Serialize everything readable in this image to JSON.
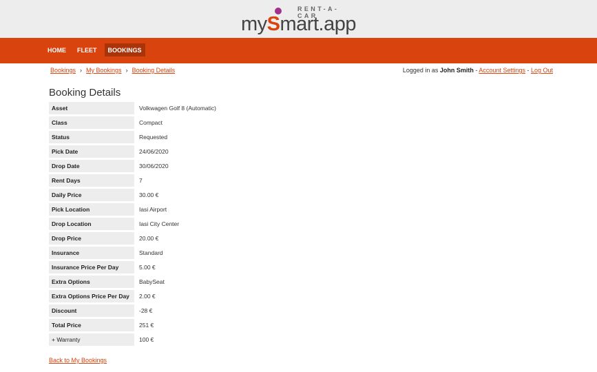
{
  "header": {
    "logo_tag": "RENT-A-CAR",
    "logo_prefix": "my",
    "logo_s": "S",
    "logo_suffix": "mart.app"
  },
  "nav": {
    "home": "HOME",
    "fleet": "FLEET",
    "bookings": "BOOKINGS"
  },
  "breadcrumb": {
    "items": [
      "Bookings",
      "My Bookings",
      "Booking Details"
    ],
    "separator": "›"
  },
  "user": {
    "logged_in_prefix": "Logged in as ",
    "name": "John Smith",
    "dash1": " - ",
    "account_settings": "Account Settings",
    "dash2": " - ",
    "logout": "Log Out"
  },
  "page_title": "Booking Details",
  "details": [
    {
      "label": "Asset",
      "value": "Volkwagen Golf 8 (Automatic)"
    },
    {
      "label": "Class",
      "value": "Compact"
    },
    {
      "label": "Status",
      "value": "Requested"
    },
    {
      "label": "Pick Date",
      "value": "24/06/2020"
    },
    {
      "label": "Drop Date",
      "value": "30/06/2020"
    },
    {
      "label": "Rent Days",
      "value": "7"
    },
    {
      "label": "Daily Price",
      "value": "30.00 €"
    },
    {
      "label": "Pick Location",
      "value": "Iasi Airport"
    },
    {
      "label": "Drop Location",
      "value": "Iasi City Center"
    },
    {
      "label": "Drop Price",
      "value": "20.00 €"
    },
    {
      "label": "Insurance",
      "value": "Standard"
    },
    {
      "label": "Insurance Price Per Day",
      "value": "5.00 €"
    },
    {
      "label": "Extra Options",
      "value": "BabySeat"
    },
    {
      "label": "Extra Options Price Per Day",
      "value": "2.00 €"
    },
    {
      "label": "Discount",
      "value": "-28 €"
    },
    {
      "label": "Total Price",
      "value": "251 €"
    },
    {
      "label": "+ Warranty",
      "value": "100 €"
    }
  ],
  "back_link": "Back to My Bookings",
  "colors": {
    "accent": "#d9430d",
    "header_bg": "#ededed",
    "label_bg": "#ededed",
    "logo_dot": "#a3308d"
  }
}
